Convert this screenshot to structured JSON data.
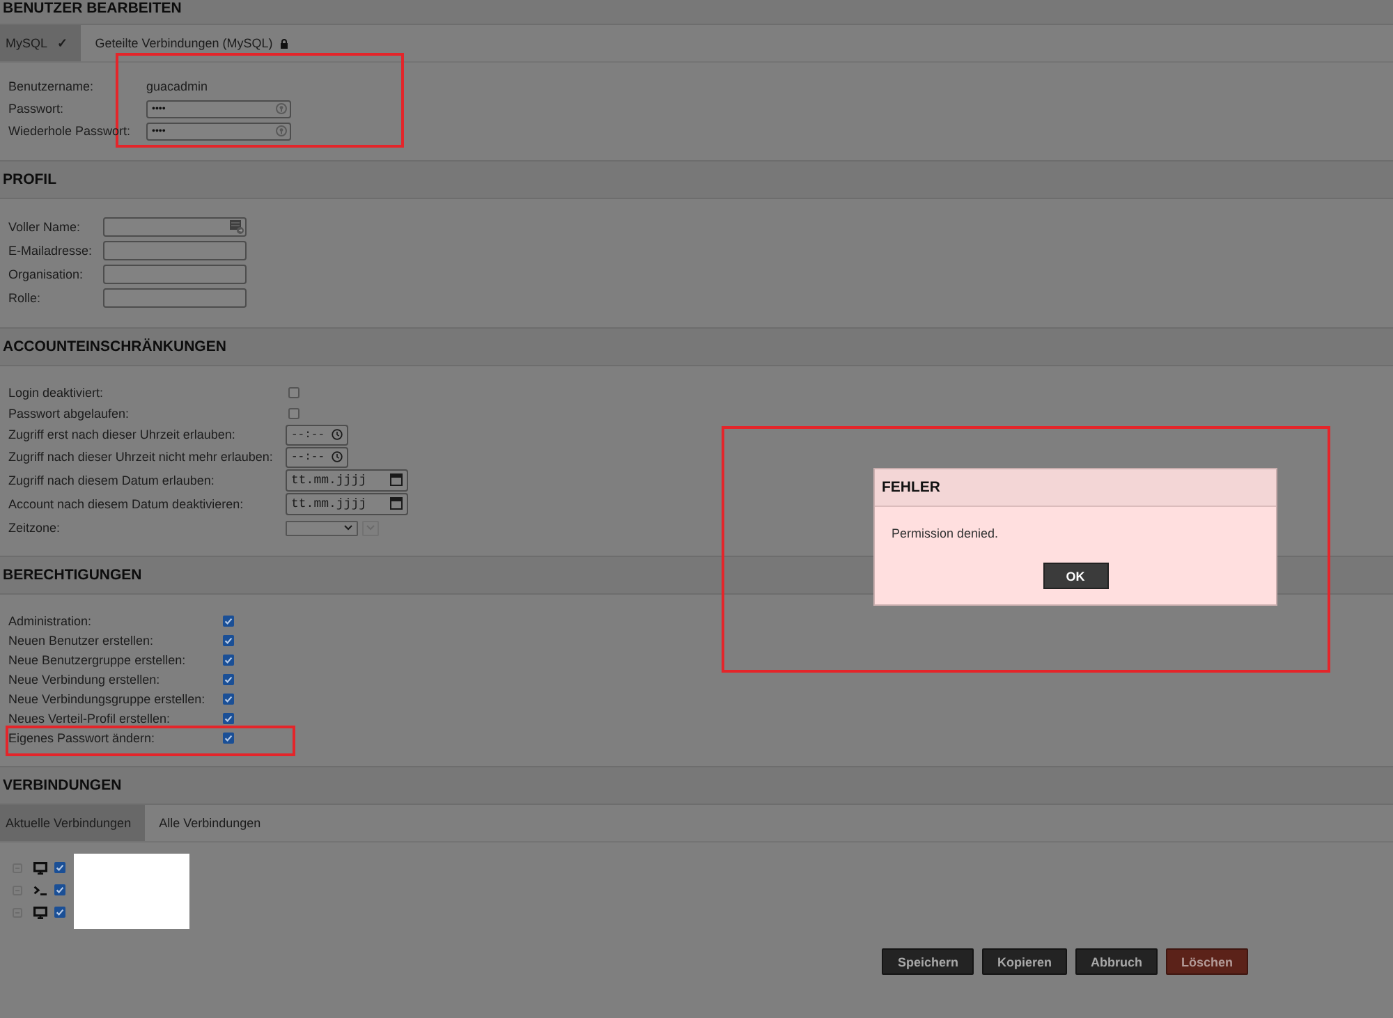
{
  "page_title": "BENUTZER BEARBEITEN",
  "account_tabs": [
    {
      "label": "MySQL",
      "badge": "✓",
      "locked": false,
      "selected": true
    },
    {
      "label": "Geteilte Verbindungen (MySQL)",
      "locked": true,
      "selected": false
    }
  ],
  "credentials": {
    "highlighted": true,
    "fields": [
      {
        "kind": "text",
        "label": "Benutzername:",
        "value": "guacadmin"
      },
      {
        "kind": "password",
        "label": "Passwort:",
        "value": "••••"
      },
      {
        "kind": "password",
        "label": "Wiederhole Passwort:",
        "value": "••••"
      }
    ]
  },
  "profile": {
    "title": "PROFIL",
    "fields": [
      {
        "kind": "contact",
        "label": "Voller Name:"
      },
      {
        "kind": "text",
        "label": "E-Mailadresse:"
      },
      {
        "kind": "text",
        "label": "Organisation:"
      },
      {
        "kind": "text",
        "label": "Rolle:"
      }
    ]
  },
  "restrictions": {
    "title": "ACCOUNTEINSCHRÄNKUNGEN",
    "items": [
      {
        "kind": "checkbox",
        "label": "Login deaktiviert:",
        "checked": false
      },
      {
        "kind": "checkbox",
        "label": "Passwort abgelaufen:",
        "checked": false
      },
      {
        "kind": "time",
        "label": "Zugriff erst nach dieser Uhrzeit erlauben:",
        "placeholder": "--:--"
      },
      {
        "kind": "time",
        "label": "Zugriff nach dieser Uhrzeit nicht mehr erlauben:",
        "placeholder": "--:--"
      },
      {
        "kind": "date",
        "label": "Zugriff nach diesem Datum erlauben:",
        "placeholder": "tt.mm.jjjj"
      },
      {
        "kind": "date",
        "label": "Account nach diesem Datum deaktivieren:",
        "placeholder": "tt.mm.jjjj"
      },
      {
        "kind": "timezone",
        "label": "Zeitzone:"
      }
    ]
  },
  "permissions": {
    "title": "BERECHTIGUNGEN",
    "items": [
      {
        "label": "Administration:",
        "checked": true,
        "highlighted": false
      },
      {
        "label": "Neuen Benutzer erstellen:",
        "checked": true,
        "highlighted": false
      },
      {
        "label": "Neue Benutzergruppe erstellen:",
        "checked": true,
        "highlighted": false
      },
      {
        "label": "Neue Verbindung erstellen:",
        "checked": true,
        "highlighted": false
      },
      {
        "label": "Neue Verbindungsgruppe erstellen:",
        "checked": true,
        "highlighted": false
      },
      {
        "label": "Neues Verteil-Profil erstellen:",
        "checked": true,
        "highlighted": false
      },
      {
        "label": "Eigenes Passwort ändern:",
        "checked": true,
        "highlighted": true
      }
    ]
  },
  "connections": {
    "title": "VERBINDUNGEN",
    "tabs": [
      {
        "label": "Aktuelle Verbindungen",
        "selected": true
      },
      {
        "label": "Alle Verbindungen",
        "selected": false
      }
    ],
    "names_redacted": true,
    "tree": [
      {
        "kind": "desktop",
        "checked": true
      },
      {
        "kind": "terminal",
        "checked": true
      },
      {
        "kind": "desktop",
        "checked": true
      }
    ]
  },
  "buttons": [
    {
      "label": "Speichern",
      "kind": "normal"
    },
    {
      "label": "Kopieren",
      "kind": "normal"
    },
    {
      "label": "Abbruch",
      "kind": "normal"
    },
    {
      "label": "Löschen",
      "kind": "danger"
    }
  ],
  "dialog": {
    "title": "FEHLER",
    "message": "Permission denied.",
    "button": "OK",
    "highlighted": true
  }
}
